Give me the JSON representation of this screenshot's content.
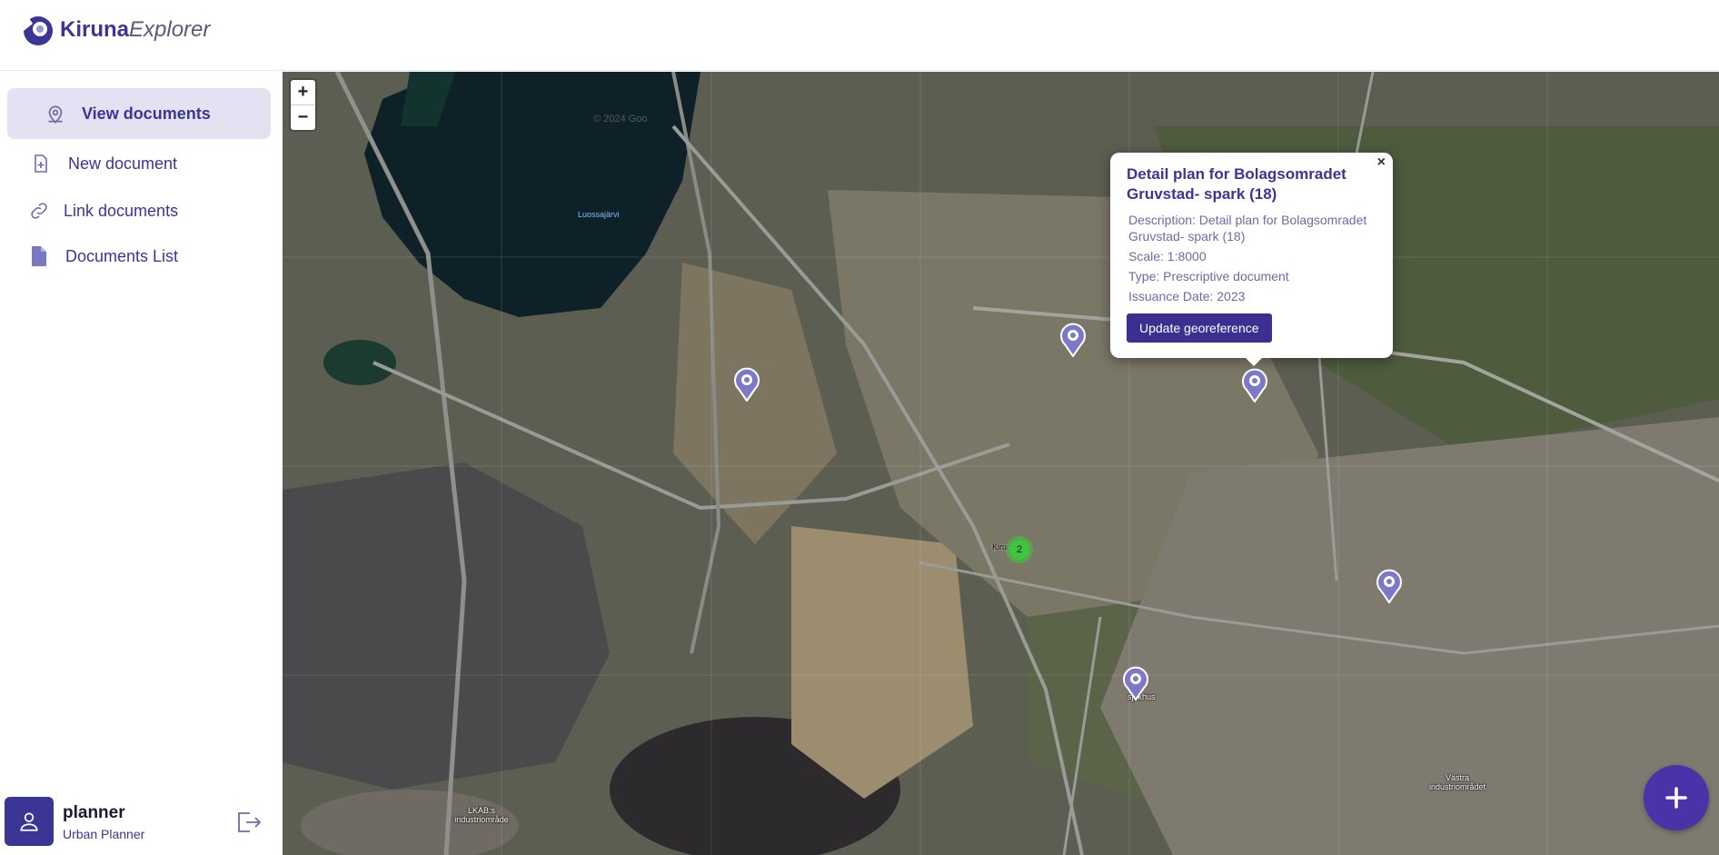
{
  "app": {
    "logo_bold": "Kiruna",
    "logo_italic": "Explorer"
  },
  "sidebar": {
    "items": [
      {
        "label": "View documents",
        "icon": "map-pin-icon",
        "active": true
      },
      {
        "label": "New document",
        "icon": "file-plus-icon",
        "active": false
      },
      {
        "label": "Link documents",
        "icon": "link-icon",
        "active": false
      },
      {
        "label": "Documents List",
        "icon": "document-icon",
        "active": false
      }
    ]
  },
  "user": {
    "name": "planner",
    "role": "Urban Planner",
    "avatar_icon": "user-icon",
    "logout_icon": "logout-icon"
  },
  "map": {
    "zoom_in": "+",
    "zoom_out": "−",
    "labels": {
      "lake": "Luossajärvi",
      "copyright": "© 2024 Goo",
      "town": "Kiruna",
      "hospital": "sjukhus",
      "industry_west": "LKAB:s industriområde",
      "industry_east": "Västra industriområdet"
    },
    "cluster_count": "2",
    "pin_icon": "document-pin-icon"
  },
  "popup": {
    "title": "Detail plan for Bolagsomradet Gruvstad- spark (18)",
    "description": "Description: Detail plan for Bolagsomradet Gruvstad- spark (18)",
    "scale": "Scale: 1:8000",
    "type": "Type: Prescriptive document",
    "issuance": "Issuance Date: 2023",
    "button": "Update georeference",
    "close": "×"
  },
  "fab": {
    "label": "+",
    "icon": "plus-icon"
  },
  "colors": {
    "accent": "#3b3596",
    "active_bg": "#e4e1f3",
    "button": "#3b2f91",
    "fab": "#4a32a8",
    "cluster": "#3ec43e"
  }
}
